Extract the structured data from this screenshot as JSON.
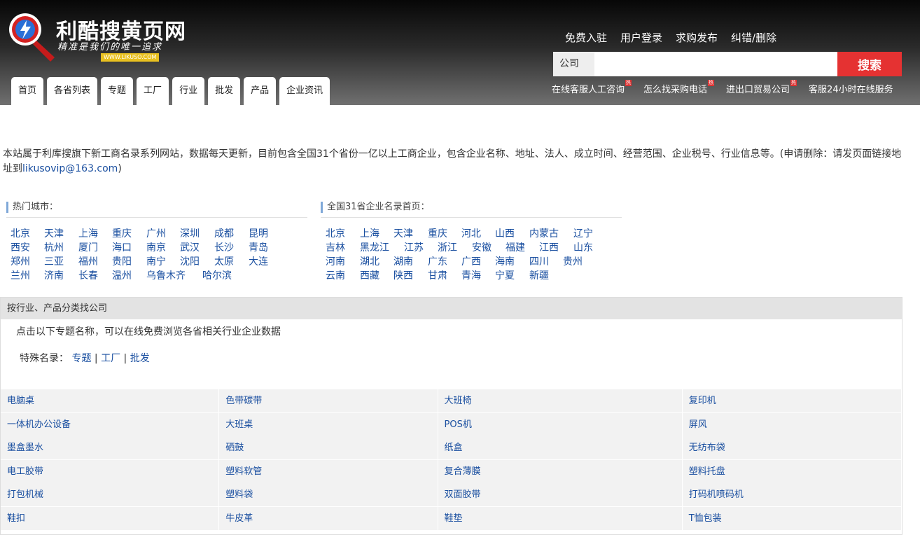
{
  "header": {
    "logo_title": "利酷搜黄页网",
    "logo_slogan": "精准是我们的唯一追求",
    "logo_domain": "WWW.LIKUSO.COM",
    "top_links": [
      "免费入驻",
      "用户登录",
      "求购发布",
      "纠错/删除"
    ],
    "search": {
      "label": "公司",
      "placeholder": "",
      "value": "",
      "button": "搜索"
    },
    "hot_links": [
      {
        "label": "在线客服人工咨询",
        "badge": "热"
      },
      {
        "label": "怎么找采购电话",
        "badge": "热"
      },
      {
        "label": "进出口贸易公司",
        "badge": "热"
      },
      {
        "label": "客服24小时在线服务",
        "badge": ""
      }
    ],
    "tabs": [
      "首页",
      "各省列表",
      "专题",
      "工厂",
      "行业",
      "批发",
      "产品",
      "企业资讯"
    ]
  },
  "intro": {
    "text": "本站属于利库搜旗下新工商名录系列网站，数据每天更新，目前包含全国31个省份一亿以上工商企业，包含企业名称、地址、法人、成立时间、经营范围、企业税号、行业信息等。(申请删除：请发页面链接地址到",
    "email": "likusovip@163.com",
    "tail": ")"
  },
  "hot_cities": {
    "title": "热门城市：",
    "rows": [
      [
        "北京",
        "天津",
        "上海",
        "重庆",
        "广州",
        "深圳",
        "成都",
        "昆明"
      ],
      [
        "西安",
        "杭州",
        "厦门",
        "海口",
        "南京",
        "武汉",
        "长沙",
        "青岛"
      ],
      [
        "郑州",
        "三亚",
        "福州",
        "贵阳",
        "南宁",
        "沈阳",
        "太原",
        "大连"
      ],
      [
        "兰州",
        "济南",
        "长春",
        "温州",
        "乌鲁木齐",
        "哈尔滨"
      ]
    ]
  },
  "provinces": {
    "title": "全国31省企业名录首页：",
    "rows": [
      [
        "北京",
        "上海",
        "天津",
        "重庆",
        "河北",
        "山西",
        "内蒙古",
        "辽宁"
      ],
      [
        "吉林",
        "黑龙江",
        "江苏",
        "浙江",
        "安徽",
        "福建",
        "江西",
        "山东"
      ],
      [
        "河南",
        "湖北",
        "湖南",
        "广东",
        "广西",
        "海南",
        "四川",
        "贵州"
      ],
      [
        "云南",
        "西藏",
        "陕西",
        "甘肃",
        "青海",
        "宁夏",
        "新疆"
      ]
    ]
  },
  "categories": {
    "header": "按行业、产品分类找公司",
    "description": "点击以下专题名称，可以在线免费浏览各省相关行业企业数据",
    "special_label": "特殊名录：",
    "special_links": [
      "专题",
      "工厂",
      "批发"
    ],
    "separator": "|",
    "rows": [
      [
        "电脑桌",
        "色带碳带",
        "大班椅",
        "复印机"
      ],
      [
        "一体机办公设备",
        "大班桌",
        "POS机",
        "屏风"
      ],
      [
        "墨盒墨水",
        "硒鼓",
        "纸盒",
        "无纺布袋"
      ],
      [
        "电工胶带",
        "塑料软管",
        "复合薄膜",
        "塑料托盘"
      ],
      [
        "打包机械",
        "塑料袋",
        "双面胶带",
        "打码机喷码机"
      ],
      [
        "鞋扣",
        "牛皮革",
        "鞋垫",
        "T恤包装"
      ]
    ]
  },
  "colors": {
    "search_button": "#e53232",
    "link": "#1a4fa0",
    "header_dark": "#070707",
    "logo_red": "#d42222"
  }
}
